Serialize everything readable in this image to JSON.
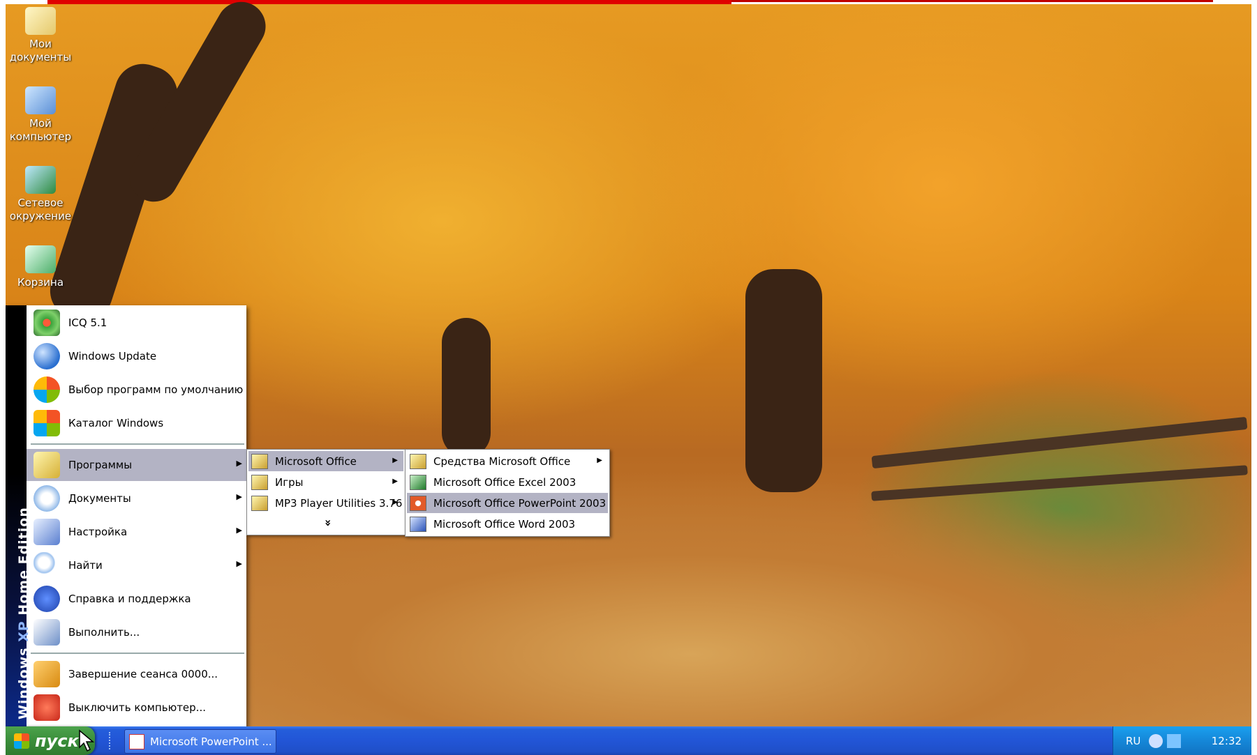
{
  "desktop": {
    "icons": [
      {
        "label": "Мои документы"
      },
      {
        "label": "Мой компьютер"
      },
      {
        "label": "Сетевое окружение"
      },
      {
        "label": "Корзина"
      }
    ]
  },
  "start_menu": {
    "sidebar": {
      "brand": "Windows",
      "xp": "XP",
      "edition": "Home Edition"
    },
    "pinned": [
      {
        "label": "ICQ 5.1",
        "icon": "icq-flower-icon"
      },
      {
        "label": "Windows Update",
        "icon": "windows-update-icon"
      },
      {
        "label": "Выбор программ по умолчанию",
        "icon": "default-programs-icon"
      },
      {
        "label": "Каталог Windows",
        "icon": "windows-catalog-icon"
      }
    ],
    "items": [
      {
        "label": "Программы",
        "icon": "programs-folder-icon"
      },
      {
        "label": "Документы",
        "icon": "documents-icon"
      },
      {
        "label": "Настройка",
        "icon": "settings-icon"
      },
      {
        "label": "Найти",
        "icon": "search-icon"
      },
      {
        "label": "Справка и поддержка",
        "icon": "help-icon"
      },
      {
        "label": "Выполнить...",
        "icon": "run-icon"
      }
    ],
    "bottom": [
      {
        "label": "Завершение сеанса 0000...",
        "icon": "log-off-icon"
      },
      {
        "label": "Выключить компьютер...",
        "icon": "shutdown-icon"
      }
    ]
  },
  "programs_submenu": {
    "items": [
      {
        "label": "Microsoft Office"
      },
      {
        "label": "Игры"
      },
      {
        "label": "MP3 Player Utilities 3.76"
      }
    ],
    "expand": "»"
  },
  "office_submenu": {
    "items": [
      {
        "label": "Средства Microsoft Office"
      },
      {
        "label": "Microsoft Office Excel 2003"
      },
      {
        "label": "Microsoft Office PowerPoint 2003"
      },
      {
        "label": "Microsoft Office Word 2003"
      }
    ]
  },
  "taskbar": {
    "start_label": "пуск",
    "task_button": "Microsoft PowerPoint ...",
    "tray": {
      "language": "RU",
      "clock": "12:32"
    }
  },
  "colors": {
    "highlight": "#b3b3c4",
    "taskbar": "#245edb",
    "start_button": "#3a8e3a",
    "tray": "#1587d8"
  }
}
